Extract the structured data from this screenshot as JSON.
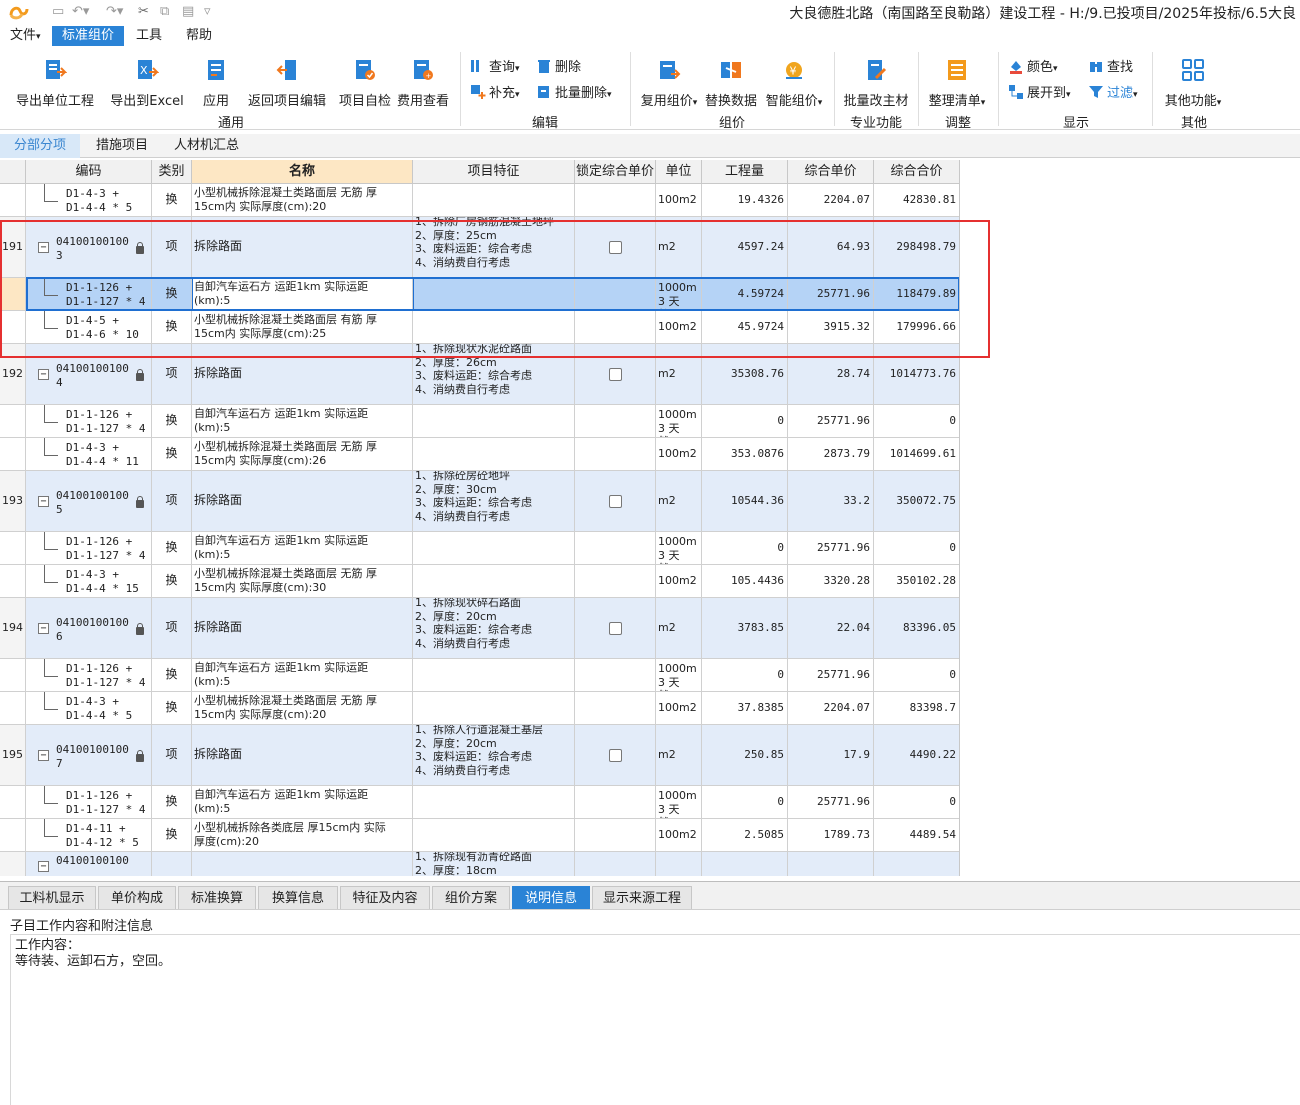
{
  "window": {
    "title": "大良德胜北路（南国路至良勒路）建设工程 - H:/9.已投项目/2025年投标/6.5大良"
  },
  "menu": {
    "items": [
      "文件",
      "标准组价",
      "工具",
      "帮助"
    ],
    "active": "标准组价"
  },
  "ribbon": {
    "common": {
      "export_unit": "导出单位工程",
      "export_excel": "导出到Excel",
      "apply": "应用",
      "return_edit": "返回项目编辑",
      "self_check": "项目自检",
      "fee_view": "费用查看",
      "group": "通用"
    },
    "edit": {
      "query": "查询",
      "delete": "删除",
      "supplement": "补充",
      "batch_delete": "批量删除",
      "group": "编辑"
    },
    "pricing": {
      "reuse": "复用组价",
      "replace": "替换数据",
      "smart": "智能组价",
      "group": "组价"
    },
    "special": {
      "batch_main": "批量改主材",
      "group": "专业功能"
    },
    "adjust": {
      "arrange": "整理清单",
      "group": "调整"
    },
    "display": {
      "color": "颜色",
      "find": "查找",
      "expand": "展开到",
      "filter": "过滤",
      "group": "显示"
    },
    "other": {
      "more": "其他功能",
      "group": "其他"
    }
  },
  "tabs": {
    "items": [
      "分部分项",
      "措施项目",
      "人材机汇总"
    ],
    "active": "分部分项"
  },
  "grid": {
    "columns": [
      "编码",
      "类别",
      "名称",
      "项目特征",
      "锁定综合单价",
      "单位",
      "工程量",
      "综合单价",
      "综合合价"
    ],
    "rows": [
      {
        "kind": "sub",
        "no": "",
        "code": [
          "D1-4-3 +",
          "D1-4-4 * 5"
        ],
        "type": "换",
        "name": [
          "小型机械拆除混凝土类路面层 无筋 厚",
          "15cm内  实际厚度(cm):20"
        ],
        "feat": [],
        "unit": "100m2",
        "qty": "19.4326",
        "price": "2204.07",
        "total": "42830.81"
      },
      {
        "kind": "item",
        "no": "191",
        "code": [
          "04100100100",
          "3"
        ],
        "type": "项",
        "name": [
          "拆除路面"
        ],
        "feat": [
          "1、拆除厂房钢筋混凝土地坪",
          "2、厚度：25cm",
          "3、废料运距：综合考虑",
          "4、消纳费自行考虑"
        ],
        "unit": "m2",
        "qty": "4597.24",
        "price": "64.93",
        "total": "298498.79"
      },
      {
        "kind": "sel",
        "no": "",
        "code": [
          "D1-1-126 +",
          "D1-1-127 * 4"
        ],
        "type": "换",
        "name": [
          "自卸汽车运石方 运距1km  实际运距",
          "(km):5"
        ],
        "feat": [],
        "unit": "1000m3 天然⋯",
        "qty": "4.59724",
        "price": "25771.96",
        "total": "118479.89"
      },
      {
        "kind": "sub",
        "no": "",
        "code": [
          "D1-4-5 +",
          "D1-4-6 * 10"
        ],
        "type": "换",
        "name": [
          "小型机械拆除混凝土类路面层 有筋 厚",
          "15cm内  实际厚度(cm):25"
        ],
        "feat": [],
        "unit": "100m2",
        "qty": "45.9724",
        "price": "3915.32",
        "total": "179996.66"
      },
      {
        "kind": "item",
        "no": "192",
        "code": [
          "04100100100",
          "4"
        ],
        "type": "项",
        "name": [
          "拆除路面"
        ],
        "feat": [
          "1、拆除现状水泥砼路面",
          "2、厚度：26cm",
          "3、废料运距：综合考虑",
          "4、消纳费自行考虑"
        ],
        "unit": "m2",
        "qty": "35308.76",
        "price": "28.74",
        "total": "1014773.76"
      },
      {
        "kind": "sub",
        "no": "",
        "code": [
          "D1-1-126 +",
          "D1-1-127 * 4"
        ],
        "type": "换",
        "name": [
          "自卸汽车运石方 运距1km  实际运距",
          "(km):5"
        ],
        "feat": [],
        "unit": "1000m3 天然⋯",
        "qty": "0",
        "price": "25771.96",
        "total": "0"
      },
      {
        "kind": "sub",
        "no": "",
        "code": [
          "D1-4-3 +",
          "D1-4-4 * 11"
        ],
        "type": "换",
        "name": [
          "小型机械拆除混凝土类路面层 无筋 厚",
          "15cm内  实际厚度(cm):26"
        ],
        "feat": [],
        "unit": "100m2",
        "qty": "353.0876",
        "price": "2873.79",
        "total": "1014699.61"
      },
      {
        "kind": "item",
        "no": "193",
        "code": [
          "04100100100",
          "5"
        ],
        "type": "项",
        "name": [
          "拆除路面"
        ],
        "feat": [
          "1、拆除砼房砼地坪",
          "2、厚度：30cm",
          "3、废料运距：综合考虑",
          "4、消纳费自行考虑"
        ],
        "unit": "m2",
        "qty": "10544.36",
        "price": "33.2",
        "total": "350072.75"
      },
      {
        "kind": "sub",
        "no": "",
        "code": [
          "D1-1-126 +",
          "D1-1-127 * 4"
        ],
        "type": "换",
        "name": [
          "自卸汽车运石方 运距1km  实际运距",
          "(km):5"
        ],
        "feat": [],
        "unit": "1000m3 天然⋯",
        "qty": "0",
        "price": "25771.96",
        "total": "0"
      },
      {
        "kind": "sub",
        "no": "",
        "code": [
          "D1-4-3 +",
          "D1-4-4 * 15"
        ],
        "type": "换",
        "name": [
          "小型机械拆除混凝土类路面层 无筋 厚",
          "15cm内  实际厚度(cm):30"
        ],
        "feat": [],
        "unit": "100m2",
        "qty": "105.4436",
        "price": "3320.28",
        "total": "350102.28"
      },
      {
        "kind": "item",
        "no": "194",
        "code": [
          "04100100100",
          "6"
        ],
        "type": "项",
        "name": [
          "拆除路面"
        ],
        "feat": [
          "1、拆除现状碎石路面",
          "2、厚度：20cm",
          "3、废料运距：综合考虑",
          "4、消纳费自行考虑"
        ],
        "unit": "m2",
        "qty": "3783.85",
        "price": "22.04",
        "total": "83396.05"
      },
      {
        "kind": "sub",
        "no": "",
        "code": [
          "D1-1-126 +",
          "D1-1-127 * 4"
        ],
        "type": "换",
        "name": [
          "自卸汽车运石方 运距1km  实际运距",
          "(km):5"
        ],
        "feat": [],
        "unit": "1000m3 天然⋯",
        "qty": "0",
        "price": "25771.96",
        "total": "0"
      },
      {
        "kind": "sub",
        "no": "",
        "code": [
          "D1-4-3 +",
          "D1-4-4 * 5"
        ],
        "type": "换",
        "name": [
          "小型机械拆除混凝土类路面层 无筋 厚",
          "15cm内  实际厚度(cm):20"
        ],
        "feat": [],
        "unit": "100m2",
        "qty": "37.8385",
        "price": "2204.07",
        "total": "83398.7"
      },
      {
        "kind": "item",
        "no": "195",
        "code": [
          "04100100100",
          "7"
        ],
        "type": "项",
        "name": [
          "拆除路面"
        ],
        "feat": [
          "1、拆除人行道混凝土基层",
          "2、厚度：20cm",
          "3、废料运距：综合考虑",
          "4、消纳费自行考虑"
        ],
        "unit": "m2",
        "qty": "250.85",
        "price": "17.9",
        "total": "4490.22"
      },
      {
        "kind": "sub",
        "no": "",
        "code": [
          "D1-1-126 +",
          "D1-1-127 * 4"
        ],
        "type": "换",
        "name": [
          "自卸汽车运石方 运距1km  实际运距",
          "(km):5"
        ],
        "feat": [],
        "unit": "1000m3 天然⋯",
        "qty": "0",
        "price": "25771.96",
        "total": "0"
      },
      {
        "kind": "sub",
        "no": "",
        "code": [
          "D1-4-11 +",
          "D1-4-12 * 5"
        ],
        "type": "换",
        "name": [
          "小型机械拆除各类底层 厚15cm内  实际",
          "厚度(cm):20"
        ],
        "feat": [],
        "unit": "100m2",
        "qty": "2.5085",
        "price": "1789.73",
        "total": "4489.54"
      },
      {
        "kind": "item",
        "no": "",
        "code": [
          "04100100100",
          ""
        ],
        "type": "",
        "name": [],
        "feat": [
          "1、拆除现有沥青砼路面",
          "2、厚度：18cm"
        ],
        "unit": "",
        "qty": "",
        "price": "",
        "total": ""
      }
    ]
  },
  "bottom_tabs": {
    "items": [
      "工料机显示",
      "单价构成",
      "标准换算",
      "换算信息",
      "特征及内容",
      "组价方案",
      "说明信息",
      "显示来源工程"
    ],
    "active": "说明信息"
  },
  "detail": {
    "title": "子目工作内容和附注信息",
    "content": "工作内容：\n等待装、运卸石方，空回。"
  }
}
